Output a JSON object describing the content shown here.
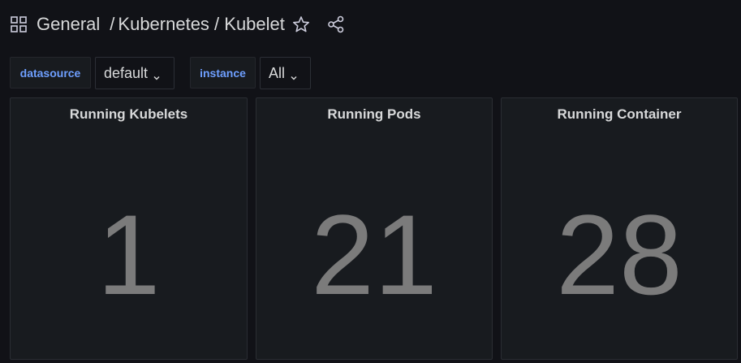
{
  "header": {
    "folder": "General",
    "separator": "/",
    "title": "Kubernetes / Kubelet",
    "icons": [
      "apps-icon",
      "star-icon",
      "share-icon"
    ]
  },
  "variables": [
    {
      "label": "datasource",
      "value": "default"
    },
    {
      "label": "instance",
      "value": "All"
    }
  ],
  "panels": [
    {
      "title": "Running Kubelets",
      "value": "1"
    },
    {
      "title": "Running Pods",
      "value": "21"
    },
    {
      "title": "Running Container",
      "value": "28"
    }
  ],
  "colors": {
    "background": "#111217",
    "panel": "#181b1f",
    "accent": "#6e9fff",
    "value": "#7b7b7b",
    "text": "#d8d9da"
  }
}
